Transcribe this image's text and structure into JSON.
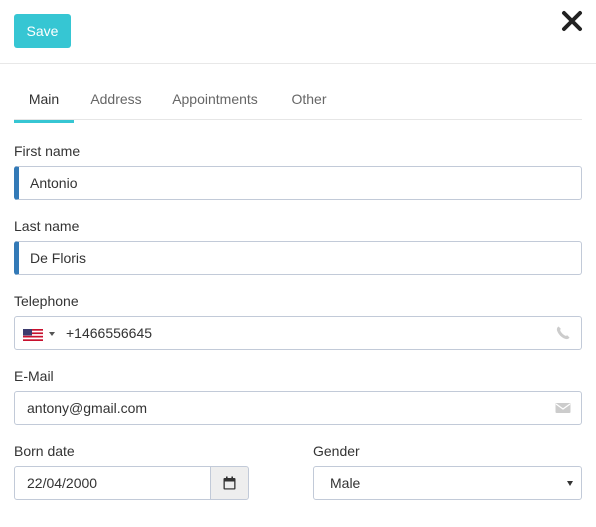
{
  "toolbar": {
    "save_label": "Save",
    "save_color": "#36c6d3"
  },
  "tabs": [
    {
      "label": "Main",
      "active": true
    },
    {
      "label": "Address",
      "active": false
    },
    {
      "label": "Appointments",
      "active": false
    },
    {
      "label": "Other",
      "active": false
    }
  ],
  "form": {
    "first_name": {
      "label": "First name",
      "value": "Antonio"
    },
    "last_name": {
      "label": "Last name",
      "value": "De Floris"
    },
    "telephone": {
      "label": "Telephone",
      "value": "+1466556645",
      "country_icon": "us-flag-icon"
    },
    "email": {
      "label": "E-Mail",
      "value": "antony@gmail.com"
    },
    "born_date": {
      "label": "Born date",
      "value": "22/04/2000"
    },
    "gender": {
      "label": "Gender",
      "value": "Male"
    }
  },
  "colors": {
    "accent": "#36c6d3",
    "required_marker": "#337ab7",
    "field_border": "#c2cad8"
  }
}
